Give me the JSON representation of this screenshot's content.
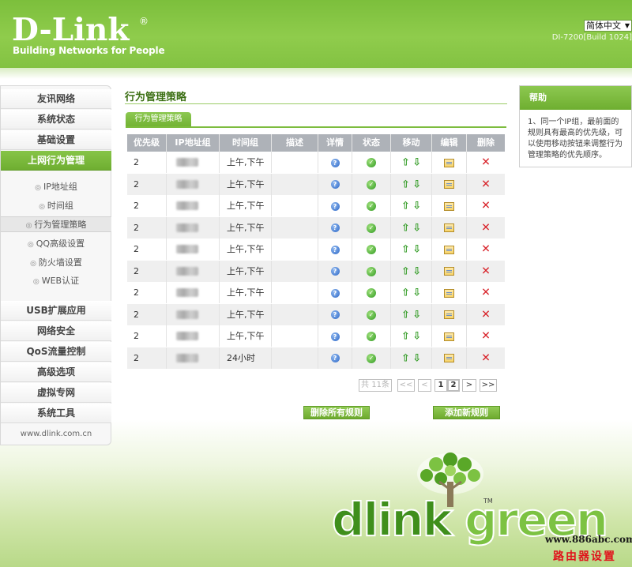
{
  "header": {
    "logo": "D-Link",
    "reg_mark": "®",
    "tagline": "Building Networks for People",
    "language": "简体中文",
    "model": "DI-7200[Build 1024]"
  },
  "sidebar": {
    "items": [
      {
        "label": "友讯网络"
      },
      {
        "label": "系统状态"
      },
      {
        "label": "基础设置"
      },
      {
        "label": "上网行为管理"
      },
      {
        "label": "USB扩展应用"
      },
      {
        "label": "网络安全"
      },
      {
        "label": "QoS流量控制"
      },
      {
        "label": "高级选项"
      },
      {
        "label": "虚拟专网"
      },
      {
        "label": "系统工具"
      }
    ],
    "subitems": [
      {
        "label": "IP地址组"
      },
      {
        "label": "时间组"
      },
      {
        "label": "行为管理策略"
      },
      {
        "label": "QQ高级设置"
      },
      {
        "label": "防火墙设置"
      },
      {
        "label": "WEB认证"
      }
    ],
    "footer": "www.dlink.com.cn"
  },
  "main": {
    "title": "行为管理策略",
    "tab": "行为管理策略",
    "columns": [
      "优先级",
      "IP地址组",
      "时间组",
      "描述",
      "详情",
      "状态",
      "移动",
      "编辑",
      "删除"
    ],
    "rows": [
      {
        "priority": "2",
        "time": "上午,下午"
      },
      {
        "priority": "2",
        "time": "上午,下午"
      },
      {
        "priority": "2",
        "time": "上午,下午"
      },
      {
        "priority": "2",
        "time": "上午,下午"
      },
      {
        "priority": "2",
        "time": "上午,下午"
      },
      {
        "priority": "2",
        "time": "上午,下午"
      },
      {
        "priority": "2",
        "time": "上午,下午"
      },
      {
        "priority": "2",
        "time": "上午,下午"
      },
      {
        "priority": "2",
        "time": "上午,下午"
      },
      {
        "priority": "2",
        "time": "24小时"
      }
    ],
    "pagination": {
      "total": "共 11条",
      "first": "<<",
      "prev": "<",
      "pages": [
        "1",
        "2"
      ],
      "next": ">",
      "last": ">>"
    },
    "buttons": {
      "delete_all": "删除所有规则",
      "add_new": "添加新规则"
    }
  },
  "help": {
    "title": "帮助",
    "text": "1、同一个IP组，最前面的规则具有最高的优先级，可以使用移动按钮来调整行为管理策略的优先顺序。"
  },
  "branding": {
    "part1": "dlink",
    "part2": "green",
    "tm": "TM"
  },
  "watermark": {
    "url": "www.886abc.com",
    "text": "路由器设置"
  },
  "icons": {
    "detail": "help-icon",
    "status": "ok-icon",
    "move_up": "arrow-up-icon",
    "move_down": "arrow-down-icon",
    "edit": "edit-icon",
    "delete": "delete-icon"
  },
  "colors": {
    "brand_green": "#7cbf3c",
    "header_text": "#ffffff",
    "table_header": "#aeb2b8",
    "delete_red": "#d8232a"
  }
}
